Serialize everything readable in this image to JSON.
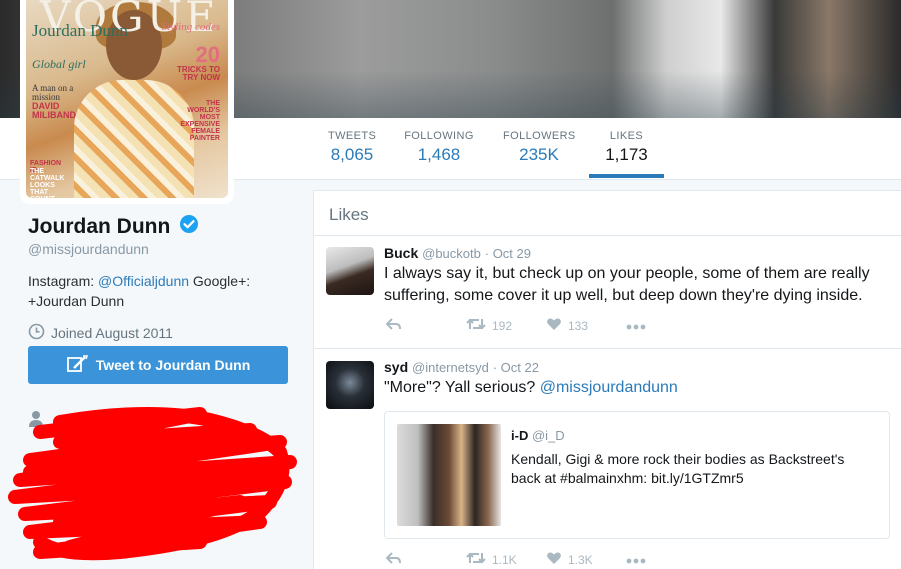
{
  "nav": {
    "stats": [
      {
        "label": "TWEETS",
        "value": "8,065"
      },
      {
        "label": "FOLLOWING",
        "value": "1,468"
      },
      {
        "label": "FOLLOWERS",
        "value": "235K"
      },
      {
        "label": "LIKES",
        "value": "1,173"
      }
    ],
    "active_index": 3
  },
  "cover_text": {
    "masthead": "VOGUE",
    "name": "Jourdan Dunn",
    "tagline": "Global girl",
    "line3": "A man on a mission",
    "line4": "DAVID MILIBAND",
    "styling": "Styling codes",
    "num": "20",
    "tricks": "TRICKS TO TRY NOW",
    "expensive": "THE WORLD'S MOST EXPENSIVE FEMALE PAINTER",
    "fashion": "FASHION ID",
    "catwalk": "THE CATWALK LOOKS THAT COUNT"
  },
  "profile": {
    "name": "Jourdan Dunn",
    "handle": "@missjourdandunn",
    "bio_prefix": "Instagram: ",
    "bio_link": "@Officialjdunn",
    "bio_suffix": " Google+: +Jourdan Dunn",
    "joined": "Joined August 2011",
    "tweet_to_label": "Tweet to Jourdan Dunn"
  },
  "likes": {
    "title": "Likes",
    "tweets": [
      {
        "name": "Buck",
        "handle": "@buckotb",
        "time": "· Oct 29",
        "text": "I always say it, but check up on your people, some of them are really suffering, some cover it up well, but deep down they're dying inside.",
        "retweets": "192",
        "likes": "133"
      },
      {
        "name": "syd",
        "handle": "@internetsyd",
        "time": "· Oct 22",
        "text_prefix": "\"More\"? Yall serious? ",
        "text_mention": "@missjourdandunn",
        "quote": {
          "name": "i-D",
          "handle": "@i_D",
          "text": "Kendall, Gigi & more rock their bodies as Backstreet's back at #balmainxhm: bit.ly/1GTZmr5"
        },
        "retweets": "1.1K",
        "likes": "1.3K"
      }
    ]
  },
  "colors": {
    "accent": "#2b7bb9",
    "button": "#3b94d9",
    "redaction": "#ff0000"
  }
}
